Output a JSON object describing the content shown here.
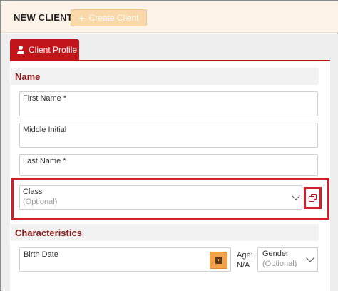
{
  "header": {
    "title": "NEW CLIENT",
    "create_button_label": "Create Client",
    "create_button_icon": "plus-icon"
  },
  "tabs": [
    {
      "label": "Client Profile",
      "icon": "person-icon",
      "active": true
    }
  ],
  "sections": {
    "name": {
      "title": "Name"
    },
    "characteristics": {
      "title": "Characteristics"
    }
  },
  "fields": {
    "first_name": {
      "label": "First Name *",
      "value": ""
    },
    "middle_initial": {
      "label": "Middle Initial",
      "value": ""
    },
    "last_name": {
      "label": "Last Name *",
      "value": ""
    },
    "class": {
      "label": "Class",
      "placeholder": "(Optional)"
    },
    "birth_date": {
      "label": "Birth Date",
      "value": ""
    },
    "age": {
      "label": "Age:",
      "value": "N/A"
    },
    "gender": {
      "label": "Gender",
      "placeholder": "(Optional)"
    }
  },
  "colors": {
    "accent_red": "#c1151b",
    "highlight_red": "#d61e2a",
    "orange": "#f4a24a",
    "header_bg": "#fdf3e9",
    "section_title": "#8b1a1a"
  }
}
